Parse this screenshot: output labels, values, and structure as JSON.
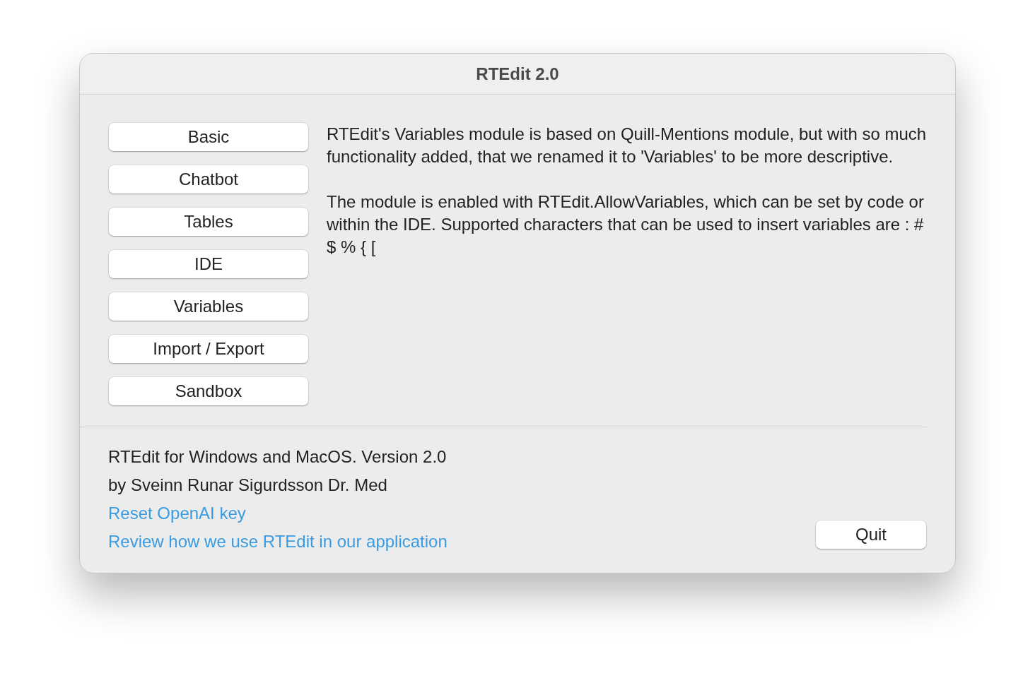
{
  "window": {
    "title": "RTEdit 2.0"
  },
  "nav_buttons": [
    "Basic",
    "Chatbot",
    "Tables",
    "IDE",
    "Variables",
    "Import / Export",
    "Sandbox"
  ],
  "description": [
    "RTEdit's Variables module is based on Quill-Mentions module, but with so much functionality added, that we renamed it to 'Variables' to be more descriptive.",
    "The module is enabled with RTEdit.AllowVariables, which can be set by code or within the IDE. Supported characters that can be used to insert variables are : # $ % { ["
  ],
  "footer": {
    "lines": [
      "RTEdit for Windows and MacOS. Version 2.0",
      "by Sveinn Runar Sigurdsson Dr. Med"
    ],
    "links": [
      "Reset OpenAI key",
      "Review how we use RTEdit in our application"
    ],
    "button": "Quit"
  }
}
